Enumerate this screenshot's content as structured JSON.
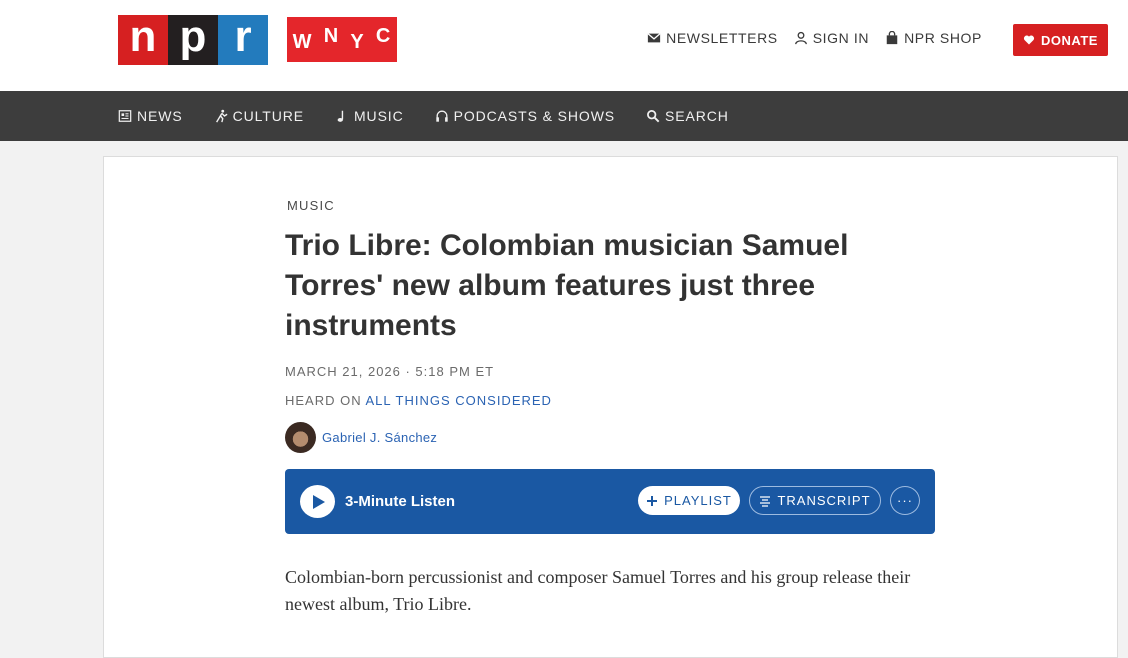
{
  "header": {
    "npr_logo_letters": [
      "n",
      "p",
      "r"
    ],
    "wnyc_logo_letters": [
      "W",
      "N",
      "Y",
      "C"
    ],
    "util_nav": [
      {
        "icon": "mail-icon",
        "label": "NEWSLETTERS"
      },
      {
        "icon": "user-icon",
        "label": "SIGN IN"
      },
      {
        "icon": "bag-icon",
        "label": "NPR SHOP"
      }
    ],
    "donate_label": "DONATE"
  },
  "nav": {
    "items": [
      {
        "icon": "news-icon",
        "label": "NEWS"
      },
      {
        "icon": "culture-icon",
        "label": "CULTURE"
      },
      {
        "icon": "music-note-icon",
        "label": "MUSIC"
      },
      {
        "icon": "headphones-icon",
        "label": "PODCASTS & SHOWS"
      },
      {
        "icon": "search-icon",
        "label": "SEARCH"
      }
    ]
  },
  "article": {
    "slug": "MUSIC",
    "headline": "Trio Libre: Colombian musician Samuel Torres' new album features just three instruments",
    "dateline": "MARCH 21, 2026 · 5:18 PM ET",
    "heard_on_prefix": "HEARD ON ",
    "heard_on_show": "ALL THINGS CONSIDERED",
    "author": "Gabriel J. Sánchez",
    "player": {
      "listen_label": "3-Minute Listen",
      "playlist_label": "PLAYLIST",
      "transcript_label": "TRANSCRIPT",
      "more_label": "···"
    },
    "body": "Colombian-born percussionist and composer Samuel Torres and his group release their newest album, Trio Libre."
  },
  "colors": {
    "npr_red": "#d62021",
    "npr_black": "#231f20",
    "npr_blue": "#237bbd",
    "wnyc_red": "#e4262b",
    "nav_bg": "#3d3d3d",
    "player_blue": "#1a58a3",
    "link_blue": "#2b63b3"
  }
}
